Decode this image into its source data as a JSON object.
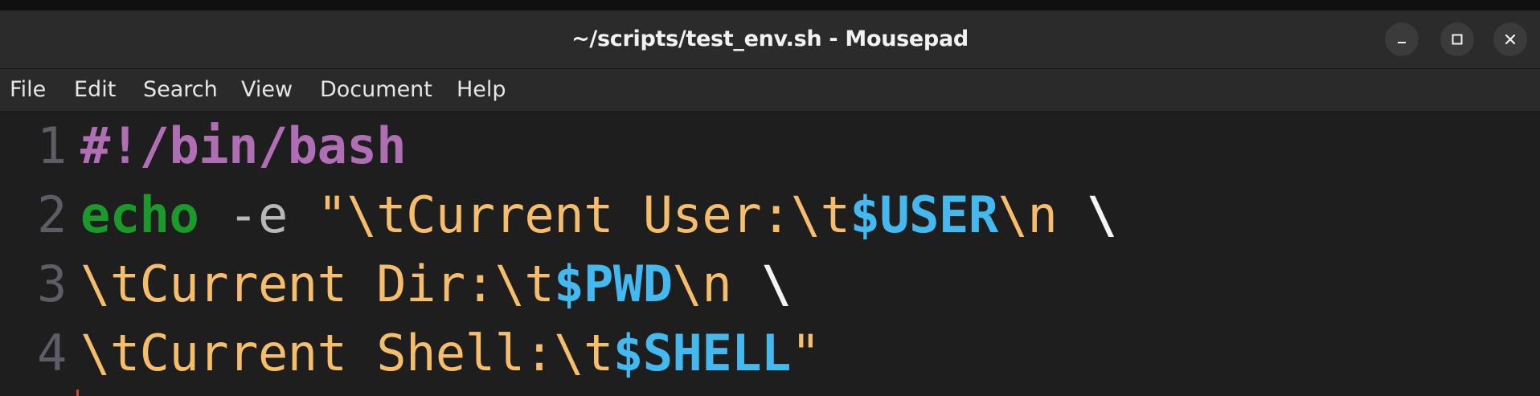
{
  "window": {
    "title": "~/scripts/test_env.sh - Mousepad",
    "controls": [
      "minimize-icon",
      "maximize-icon",
      "close-icon"
    ]
  },
  "menu": {
    "file": "File",
    "edit": "Edit",
    "search": "Search",
    "view": "View",
    "document": "Document",
    "help": "Help"
  },
  "editor": {
    "lines": [
      {
        "number": "1",
        "tokens": [
          {
            "type": "shebang",
            "text": "#!/bin/bash"
          }
        ]
      },
      {
        "number": "2",
        "tokens": [
          {
            "type": "keyword",
            "text": "echo"
          },
          {
            "type": "plain",
            "text": " "
          },
          {
            "type": "flag",
            "text": "-e"
          },
          {
            "type": "plain",
            "text": " "
          },
          {
            "type": "string",
            "text": "\"\\tCurrent User:\\t"
          },
          {
            "type": "var",
            "text": "$USER"
          },
          {
            "type": "string",
            "text": "\\n "
          },
          {
            "type": "cont",
            "text": "\\"
          }
        ]
      },
      {
        "number": "3",
        "tokens": [
          {
            "type": "string",
            "text": "\\tCurrent Dir:\\t"
          },
          {
            "type": "var",
            "text": "$PWD"
          },
          {
            "type": "string",
            "text": "\\n "
          },
          {
            "type": "cont",
            "text": "\\"
          }
        ]
      },
      {
        "number": "4",
        "tokens": [
          {
            "type": "string",
            "text": "\\tCurrent Shell:\\t"
          },
          {
            "type": "var",
            "text": "$SHELL"
          },
          {
            "type": "string",
            "text": "\""
          }
        ]
      }
    ]
  },
  "colors": {
    "shebang": "#b06fb5",
    "keyword": "#1a9a2a",
    "string": "#f6bd6a",
    "variable": "#44b9f0",
    "line_number": "#5d5d66",
    "background": "#1e1e1e"
  }
}
